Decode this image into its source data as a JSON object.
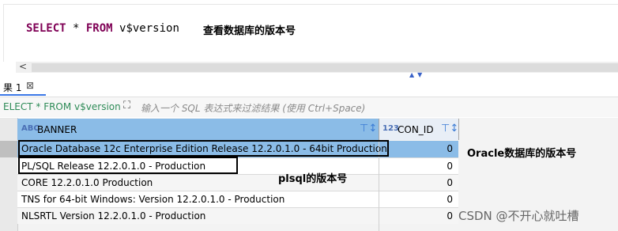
{
  "editor": {
    "sql_select": "SELECT",
    "sql_star": " * ",
    "sql_from": "FROM",
    "sql_table": " v$version",
    "annotation": "查看数据库的版本号"
  },
  "scroll": {
    "left_arrow": "<",
    "resize_arrows": "▲▼"
  },
  "results_tab": {
    "label": "果 1",
    "close_icon": "⊠"
  },
  "filter_bar": {
    "query_text": "ELECT * FROM v$version",
    "filter_icon": "⛶",
    "placeholder": "输入一个 SQL 表达式来过滤结果 (使用 Ctrl+Space)"
  },
  "columns": [
    {
      "type_icon": "ABC",
      "name": "BANNER",
      "sort_icon": "⊤↕"
    },
    {
      "type_icon": "123",
      "name": "CON_ID",
      "sort_icon": "⊤↕"
    }
  ],
  "rows": [
    {
      "banner": "Oracle Database 12c Enterprise Edition Release 12.2.0.1.0 - 64bit Production",
      "con_id": "0"
    },
    {
      "banner": "PL/SQL Release 12.2.0.1.0 - Production",
      "con_id": "0"
    },
    {
      "banner": "CORE 12.2.0.1.0 Production",
      "con_id": "0"
    },
    {
      "banner": "TNS for 64-bit Windows: Version 12.2.0.1.0 - Production",
      "con_id": "0"
    },
    {
      "banner": "NLSRTL Version 12.2.0.1.0 - Production",
      "con_id": "0"
    }
  ],
  "annotations": {
    "oracle_version": "Oracle数据库的版本号",
    "plsql_version": "plsql的版本号"
  },
  "watermark": "CSDN @不开心就吐槽"
}
